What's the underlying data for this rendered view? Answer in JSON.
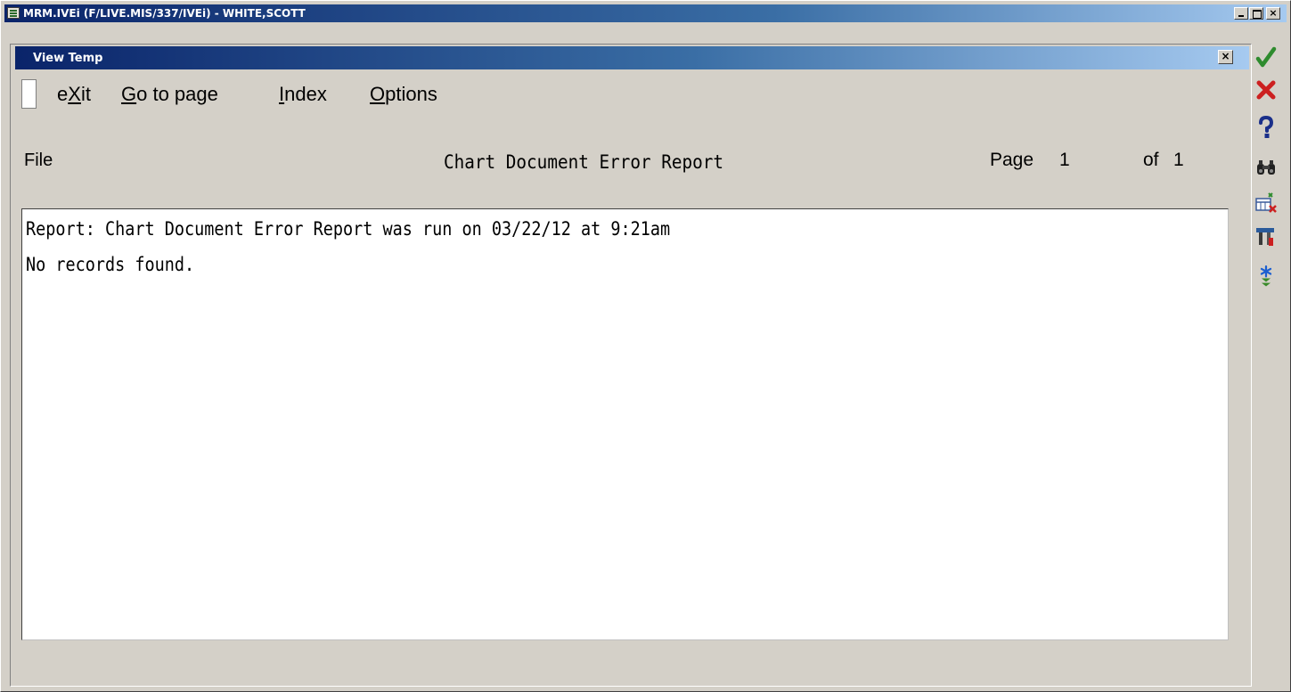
{
  "window": {
    "title": "MRM.IVEi (F/LIVE.MIS/337/IVEi) - WHITE,SCOTT",
    "minimize_glyph": "",
    "maximize_glyph": "",
    "close_glyph": "×"
  },
  "subwindow": {
    "title": "View Temp",
    "close_glyph": "×"
  },
  "menu": {
    "exit": {
      "pre": "e",
      "key": "X",
      "post": "it"
    },
    "goto": {
      "pre": "",
      "key": "G",
      "post": "o to page"
    },
    "index": {
      "pre": "",
      "key": "I",
      "post": "ndex"
    },
    "options": {
      "pre": "",
      "key": "O",
      "post": "ptions"
    }
  },
  "header": {
    "file": "File",
    "title": "Chart Document Error Report",
    "page_label": "Page",
    "page_number": "1",
    "of_label": "of",
    "total_pages": "1"
  },
  "report": {
    "lines": [
      "Report: Chart Document Error Report was run on 03/22/12 at 9:21am",
      "No records found."
    ]
  },
  "toolbar": {
    "icons": [
      "check-icon",
      "x-icon",
      "question-icon",
      "binoculars-icon",
      "table-icon",
      "tools-icon",
      "star-icon",
      "chevron-down-icon"
    ],
    "colors": {
      "ok": "#2e8b2e",
      "cancel": "#cc2020",
      "help": "#1a2f8a",
      "star": "#1c5fd0",
      "chevron": "#3a8a2a"
    }
  }
}
